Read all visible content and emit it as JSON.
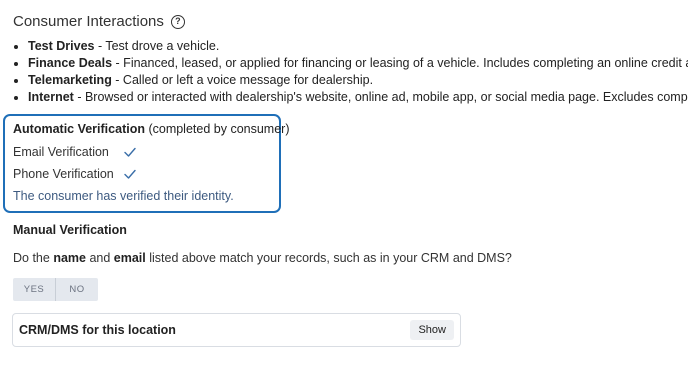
{
  "section": {
    "title": "Consumer Interactions",
    "help_icon": "question-circle-icon"
  },
  "interactions": [
    {
      "term": "Test Drives",
      "desc": " - Test drove a vehicle."
    },
    {
      "term": "Finance Deals",
      "desc": " - Financed, leased, or applied for financing or leasing of a vehicle. Includes completing an online credit applica"
    },
    {
      "term": "Telemarketing",
      "desc": " - Called or left a voice message for dealership."
    },
    {
      "term": "Internet",
      "desc": " - Browsed or interacted with dealership's website, online ad, mobile app, or social media page. Excludes completing"
    }
  ],
  "automatic": {
    "title": "Automatic Verification",
    "note": " (completed by consumer)",
    "rows": [
      {
        "label": "Email Verification",
        "icon": "check-icon"
      },
      {
        "label": "Phone Verification",
        "icon": "check-icon"
      }
    ],
    "message": "The consumer has verified their identity.",
    "accent": "#1f6fb8"
  },
  "manual": {
    "title": "Manual Verification",
    "q_prefix": "Do the ",
    "q_name": "name",
    "q_and": " and ",
    "q_email": "email",
    "q_suffix": " listed above match your records, such as in your CRM and DMS?",
    "yes_label": "YES",
    "no_label": "NO"
  },
  "crm": {
    "title": "CRM/DMS for this location",
    "show_label": "Show"
  }
}
